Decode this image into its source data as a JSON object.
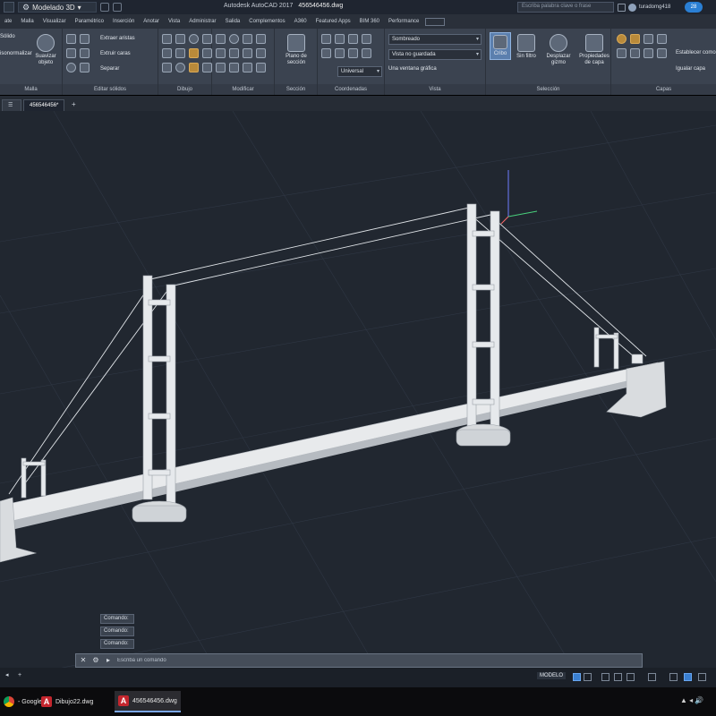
{
  "titlebar": {
    "workspace": "Modelado 3D",
    "app_title": "Autodesk AutoCAD 2017",
    "file_name": "456546456.dwg",
    "search_placeholder": "Escriba palabra clave o frase",
    "user": "turadomg418"
  },
  "ribbon_tabs": [
    "ate",
    "Malla",
    "Visualizar",
    "Paramétrico",
    "Inserción",
    "Anotar",
    "Vista",
    "Administrar",
    "Salida",
    "Complementos",
    "A360",
    "Featured Apps",
    "BIM 360",
    "Performance"
  ],
  "ribbon": {
    "malla": {
      "title": "Malla",
      "item1": "Sólido",
      "item2": "Suavizar objeto",
      "item3": "isonormalizar"
    },
    "editar_solidos": {
      "title": "Editar sólidos",
      "extrude_edges": "Extraer aristas",
      "extrude_faces": "Extruir caras",
      "separate": "Separar"
    },
    "dibujo": {
      "title": "Dibujo"
    },
    "modificar": {
      "title": "Modificar"
    },
    "seccion": {
      "title": "Sección",
      "plane": "Plano de sección"
    },
    "coordenadas": {
      "title": "Coordenadas",
      "ucs": "Universal"
    },
    "vista": {
      "title": "Vista",
      "visual_style": "Sombreado",
      "named_view": "Vista no guardada",
      "viewport": "Una ventana gráfica"
    },
    "seleccion": {
      "title": "Selección",
      "cull": "Cribo",
      "no_filter": "Sin filtro",
      "gizmo": "Desplazar gizmo"
    },
    "capas": {
      "title": "Capas",
      "layer_props": "Propiedades de capa",
      "set_current": "Establecer como",
      "match": "Igualar capa"
    }
  },
  "doc_tabs": {
    "tab1": "456546456*"
  },
  "command": {
    "history": [
      "Comando:",
      "Comando:",
      "Comando:"
    ],
    "placeholder": "Escriba un comando"
  },
  "status": {
    "model": "MODELO"
  },
  "taskbar": {
    "chrome": "- Google ...",
    "dibujo": "Dibujo22.dwg",
    "acad": "456546456.dwg"
  },
  "colors": {
    "viewport_bg": "#212730",
    "bridge": "#e8eaec",
    "ucs_x": "#49d07c",
    "ucs_z": "#6f7eff"
  }
}
